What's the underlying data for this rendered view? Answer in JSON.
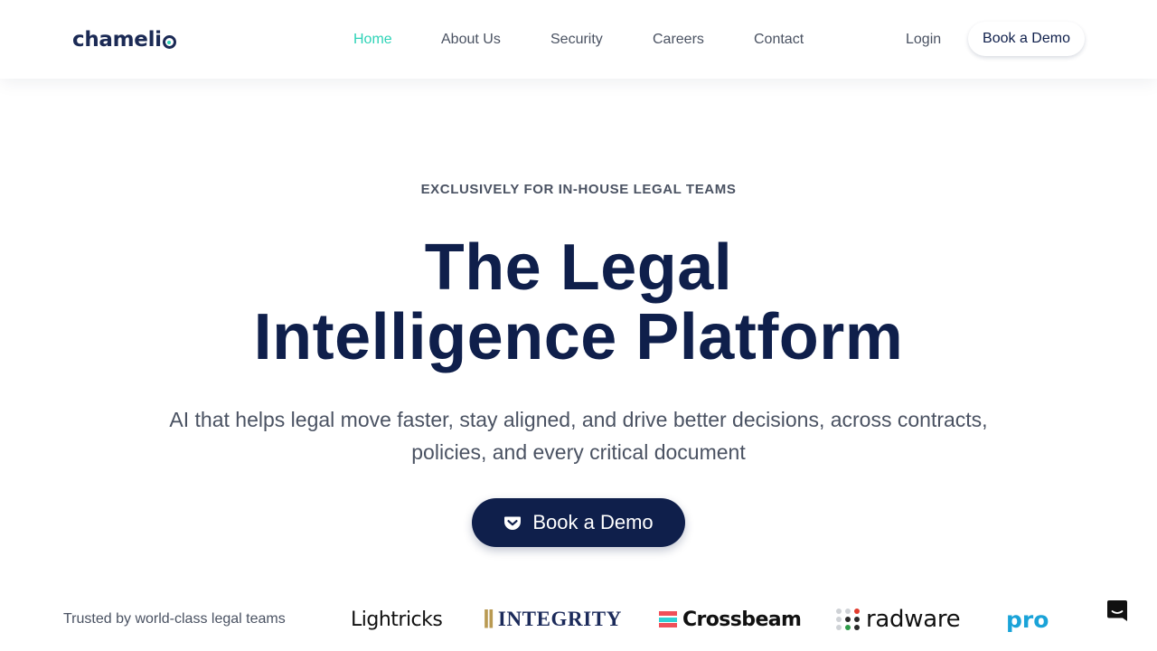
{
  "nav": {
    "logo_text": "chameli",
    "links": [
      {
        "label": "Home",
        "active": true
      },
      {
        "label": "About Us",
        "active": false
      },
      {
        "label": "Security",
        "active": false
      },
      {
        "label": "Careers",
        "active": false
      },
      {
        "label": "Contact",
        "active": false
      }
    ],
    "login_label": "Login",
    "demo_label": "Book a Demo"
  },
  "hero": {
    "eyebrow": "EXCLUSIVELY FOR IN-HOUSE LEGAL TEAMS",
    "headline_line1": "The Legal",
    "headline_line2": "Intelligence Platform",
    "subhead": "AI that helps legal move faster, stay aligned, and drive better decisions, across contracts, policies, and every critical document",
    "cta_label": "Book a Demo",
    "cta_icon": "pocket-icon"
  },
  "trust": {
    "label": "Trusted by world-class legal teams",
    "logos": [
      "Lightricks",
      "INTEGRITY",
      "Crossbeam",
      "radware",
      "prot"
    ]
  },
  "chat": {
    "icon": "chat-icon"
  },
  "colors": {
    "brand_navy": "#0f1f4b",
    "accent_teal": "#2ed3b7",
    "body_gray": "#4a5262"
  }
}
